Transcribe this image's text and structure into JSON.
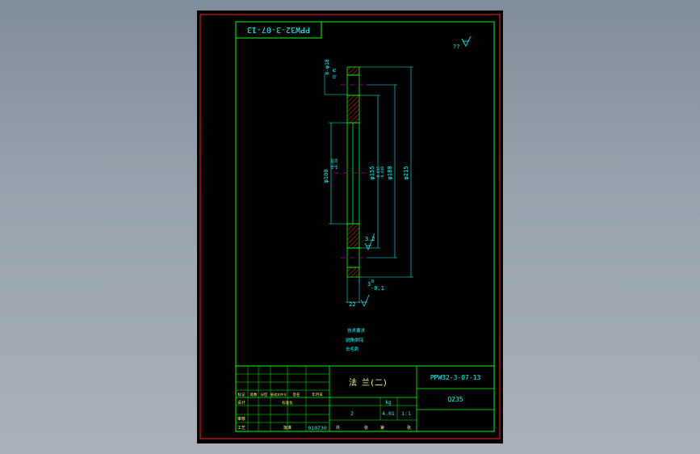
{
  "colors": {
    "background": "#000000",
    "frame": "#ff2020",
    "outline": "#00ff00",
    "dimension": "#00ffff",
    "center_line": "#ff00ff",
    "hatch": "#ff2020",
    "text": "#00ffff",
    "title_text": "#ffff80"
  },
  "drawing": {
    "top_label": "PPW32-3-07-13",
    "roughness_corner": "??",
    "hole_label": "8-φ18",
    "hole_note": "均 布",
    "dim_bore_left": "φ100",
    "dim_bore_left_tol": "+0.05\n+0.10",
    "dim_inner": "φ155",
    "dim_inner_tol": "-0.015\n-0.040",
    "dim_pcd": "φ180",
    "dim_outer": "φ215",
    "roughness_face": "3.2",
    "thickness_tol_upper": "0",
    "thickness_tol_lower": "-0.1",
    "thickness_label": "3",
    "width_label": "22",
    "notes": [
      "技术要求",
      "锐角倒钝",
      "去毛刺"
    ]
  },
  "title_block": {
    "part_name": "法  兰(二)",
    "drawing_no": "PPW32-3-07-13",
    "material": "Q235",
    "weight_label": "kg",
    "scale": "1:1",
    "quantity": "2",
    "mass": "4.01",
    "date_code": "010730",
    "left_labels": [
      "标记",
      "处数",
      "分区",
      "更改文件号",
      "签名",
      "年月日"
    ],
    "row_labels": [
      "设计",
      "标准化",
      "审核",
      "工艺",
      "批准"
    ],
    "sheet_labels": [
      "共",
      "张",
      "第",
      "张"
    ]
  }
}
